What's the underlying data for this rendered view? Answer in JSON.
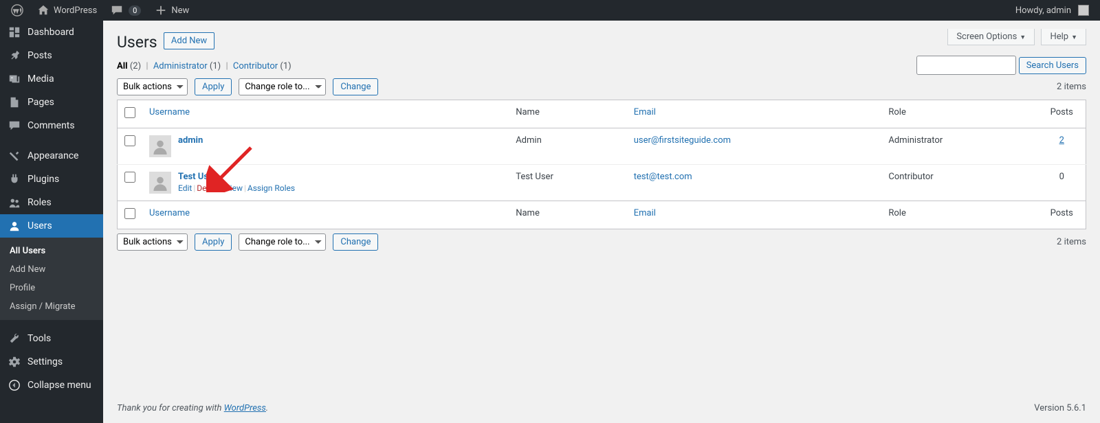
{
  "adminbar": {
    "site_name": "WordPress",
    "comments_count": "0",
    "new_label": "New",
    "howdy": "Howdy, admin"
  },
  "sidebar": {
    "items": [
      {
        "icon": "dashboard",
        "label": "Dashboard"
      },
      {
        "icon": "pin",
        "label": "Posts"
      },
      {
        "icon": "media",
        "label": "Media"
      },
      {
        "icon": "page",
        "label": "Pages"
      },
      {
        "icon": "comment",
        "label": "Comments"
      },
      {
        "icon": "appearance",
        "label": "Appearance"
      },
      {
        "icon": "plugin",
        "label": "Plugins"
      },
      {
        "icon": "roles",
        "label": "Roles"
      },
      {
        "icon": "users",
        "label": "Users"
      },
      {
        "icon": "tools",
        "label": "Tools"
      },
      {
        "icon": "settings",
        "label": "Settings"
      },
      {
        "icon": "collapse",
        "label": "Collapse menu"
      }
    ],
    "submenu": [
      "All Users",
      "Add New",
      "Profile",
      "Assign / Migrate"
    ]
  },
  "screen": {
    "options_label": "Screen Options",
    "help_label": "Help"
  },
  "page": {
    "title": "Users",
    "add_new": "Add New"
  },
  "filters": {
    "all_label": "All",
    "all_count": "(2)",
    "admin_label": "Administrator",
    "admin_count": "(1)",
    "contrib_label": "Contributor",
    "contrib_count": "(1)"
  },
  "actions": {
    "bulk_label": "Bulk actions",
    "apply": "Apply",
    "change_role": "Change role to...",
    "change": "Change",
    "items_count": "2 items",
    "search_btn": "Search Users"
  },
  "table": {
    "headers": {
      "username": "Username",
      "name": "Name",
      "email": "Email",
      "role": "Role",
      "posts": "Posts"
    },
    "rows": [
      {
        "username": "admin",
        "name": "Admin",
        "email": "user@firstsiteguide.com",
        "role": "Administrator",
        "posts": "2",
        "show_actions": false
      },
      {
        "username": "Test User",
        "name": "Test User",
        "email": "test@test.com",
        "role": "Contributor",
        "posts": "0",
        "show_actions": true
      }
    ],
    "row_actions": {
      "edit": "Edit",
      "delete": "Delete",
      "view": "View",
      "assign": "Assign Roles"
    }
  },
  "footer": {
    "thanks": "Thank you for creating with ",
    "wp": "WordPress",
    "version": "Version 5.6.1"
  }
}
